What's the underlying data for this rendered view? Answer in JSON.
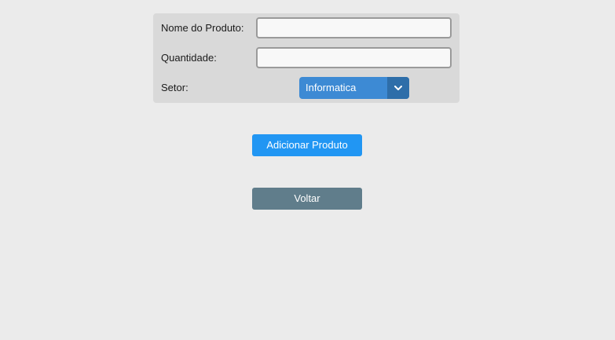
{
  "form": {
    "product_name": {
      "label": "Nome do Produto:",
      "value": ""
    },
    "quantity": {
      "label": "Quantidade:",
      "value": ""
    },
    "sector": {
      "label": "Setor:",
      "selected": "Informatica"
    }
  },
  "actions": {
    "add_label": "Adicionar Produto",
    "back_label": "Voltar"
  },
  "colors": {
    "page_background": "#ebebeb",
    "panel_background": "#d9d9d9",
    "select_background": "#3d8ad4",
    "select_arrow_background": "#2e6ea9",
    "add_button": "#2196f3",
    "back_button": "#607d8b"
  },
  "icons": {
    "select_arrow": "chevron-down-icon"
  }
}
